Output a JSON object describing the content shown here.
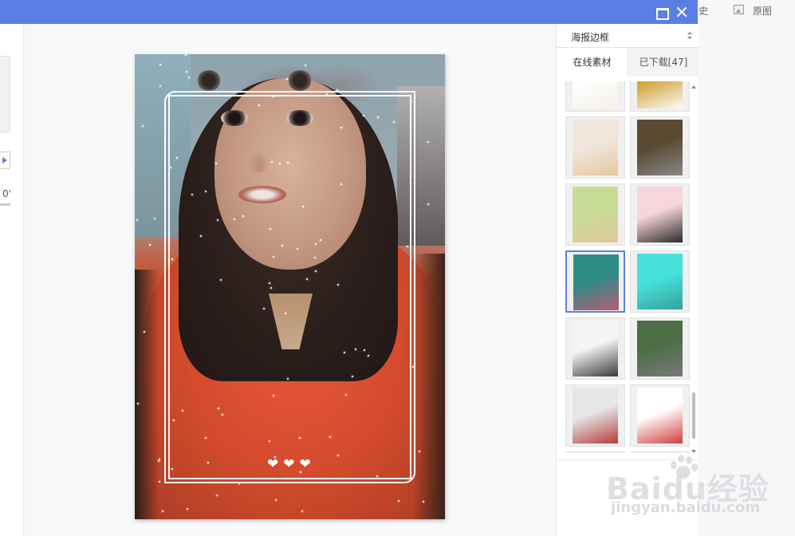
{
  "window": {
    "maximize_icon": "maximize-icon",
    "close_icon": "close-icon"
  },
  "background_toolbar": {
    "history_partial": "史",
    "original_label": "原图",
    "original_icon": "image-icon"
  },
  "left_panel": {
    "partial_value": "0'"
  },
  "editor": {
    "photo_hearts": "❤❤❤"
  },
  "material_panel": {
    "category_select": "海报边框",
    "tabs": [
      {
        "label": "在线素材",
        "active": true
      },
      {
        "label": "已下载[47]",
        "active": false
      }
    ],
    "thumbnails": [
      {
        "name": "poster-frame-01",
        "colors": [
          "#ffffff",
          "#f5f0e6"
        ]
      },
      {
        "name": "poster-frame-02",
        "colors": [
          "#d2a43c",
          "#fbfaf5"
        ]
      },
      {
        "name": "poster-frame-03",
        "colors": [
          "#f0e6dc",
          "#e6c7a0"
        ]
      },
      {
        "name": "poster-frame-04",
        "colors": [
          "#5a4a32",
          "#888888"
        ]
      },
      {
        "name": "poster-frame-05",
        "colors": [
          "#c8dc96",
          "#e1c89a"
        ]
      },
      {
        "name": "poster-frame-06",
        "colors": [
          "#f7d5da",
          "#2a2a2a"
        ]
      },
      {
        "name": "poster-frame-07",
        "colors": [
          "#2e8c87",
          "#b45c75"
        ],
        "selected": true
      },
      {
        "name": "poster-frame-08",
        "colors": [
          "#46e1dc",
          "#37a19b"
        ]
      },
      {
        "name": "poster-frame-09",
        "colors": [
          "#f5f5f5",
          "#3a3a3a"
        ]
      },
      {
        "name": "poster-frame-10",
        "colors": [
          "#4d6e45",
          "#7a7a7a"
        ]
      },
      {
        "name": "poster-frame-11",
        "colors": [
          "#e6e6e6",
          "#b43c3c"
        ]
      },
      {
        "name": "poster-frame-12",
        "colors": [
          "#ffffff",
          "#d23c3c"
        ]
      },
      {
        "name": "poster-frame-13",
        "colors": [
          "#1e2a3a",
          "#ffffff"
        ]
      },
      {
        "name": "poster-frame-14",
        "colors": [
          "#5a82c8",
          "#ffffff"
        ]
      }
    ]
  },
  "watermark": {
    "brand": "Baidu经验",
    "url": "jingyan.baidu.com"
  },
  "colors": {
    "accent": "#5b7ee5",
    "panel_bg": "#ffffff",
    "canvas_bg": "#f7f8fa"
  }
}
